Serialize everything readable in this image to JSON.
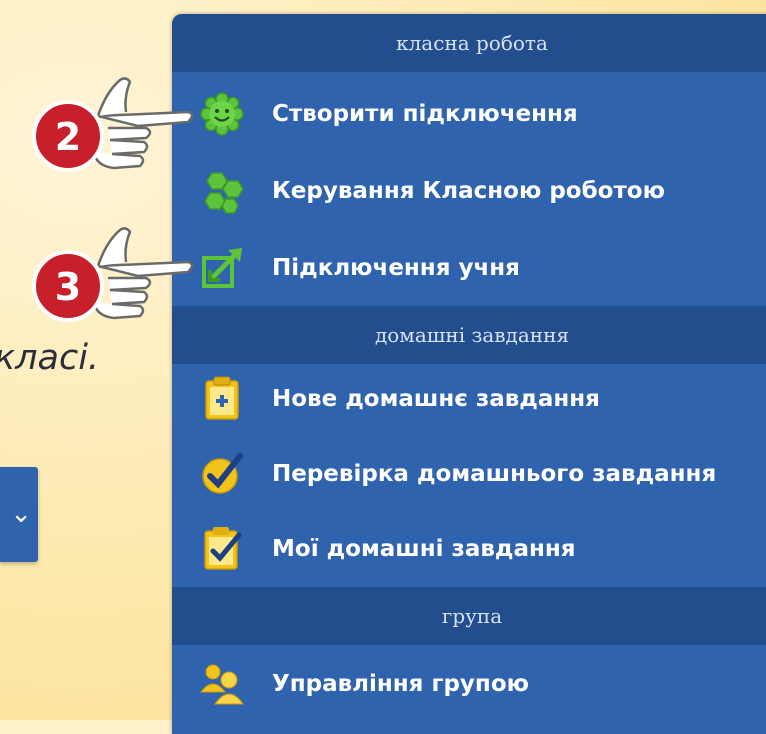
{
  "left": {
    "fragment_text": "класі.",
    "button_glyph": "⌄"
  },
  "markers": [
    {
      "number": "2"
    },
    {
      "number": "3"
    }
  ],
  "sections": [
    {
      "title": "класна робота",
      "items": [
        {
          "label": "Створити підключення",
          "icon": "green-smiley-gear-icon"
        },
        {
          "label": "Керування Класною роботою",
          "icon": "green-hexagons-icon"
        },
        {
          "label": "Підключення учня",
          "icon": "green-arrows-connect-icon"
        }
      ]
    },
    {
      "title": "домашні завдання",
      "items": [
        {
          "label": "Нове домашнє завдання",
          "icon": "clipboard-plus-icon"
        },
        {
          "label": "Перевірка домашнього завдання",
          "icon": "checkmark-circle-icon"
        },
        {
          "label": "Мої домашні завдання",
          "icon": "clipboard-check-icon"
        }
      ]
    },
    {
      "title": "група",
      "items": [
        {
          "label": "Управління групою",
          "icon": "group-people-icon"
        }
      ]
    }
  ],
  "colors": {
    "panel_bg": "#2f63ad",
    "header_bg": "#234e8e",
    "marker_red": "#c8202a",
    "icon_green": "#5cc43a",
    "icon_yellow": "#f2c318"
  }
}
